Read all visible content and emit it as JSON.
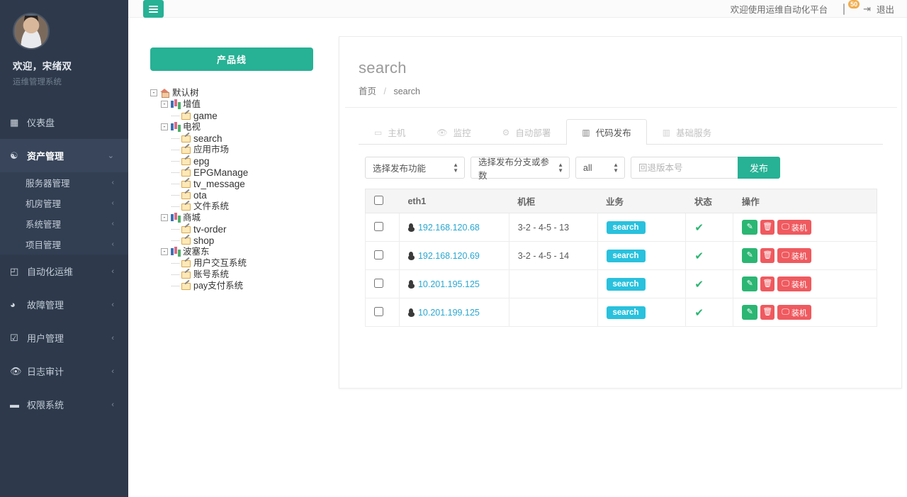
{
  "sidebar": {
    "profile": {
      "avatar_icon": "user-avatar",
      "welcome": "欢迎，宋绪双",
      "subtitle": "运维管理系统"
    },
    "items": [
      {
        "label": "仪表盘",
        "icon": "dashboard-icon",
        "active": false,
        "chevron": ""
      },
      {
        "label": "资产管理",
        "icon": "assets-icon",
        "active": true,
        "chevron": "⌄"
      },
      {
        "label": "自动化运维",
        "icon": "box-icon",
        "active": false,
        "chevron": "‹"
      },
      {
        "label": "故障管理",
        "icon": "bug-icon",
        "active": false,
        "chevron": "‹"
      },
      {
        "label": "用户管理",
        "icon": "edit-square-icon",
        "active": false,
        "chevron": "‹"
      },
      {
        "label": "日志审计",
        "icon": "eye-icon",
        "active": false,
        "chevron": "‹"
      },
      {
        "label": "权限系统",
        "icon": "briefcase-icon",
        "active": false,
        "chevron": "‹"
      }
    ],
    "subitems": [
      {
        "label": "服务器管理",
        "chevron": "‹"
      },
      {
        "label": "机房管理",
        "chevron": "‹"
      },
      {
        "label": "系统管理",
        "chevron": "‹"
      },
      {
        "label": "项目管理",
        "chevron": "‹"
      }
    ]
  },
  "topbar": {
    "menu_toggle_icon": "hamburger-icon",
    "welcome_text": "欢迎使用运维自动化平台",
    "mail_icon": "envelope-icon",
    "mail_badge": "50",
    "logout_icon": "logout-icon",
    "logout_label": "退出"
  },
  "tree_panel": {
    "product_line_button": "产品线",
    "nodes": [
      {
        "depth": 0,
        "toggle": "-",
        "icon": "home-icon",
        "label": "默认树",
        "latin": false
      },
      {
        "depth": 1,
        "toggle": "-",
        "icon": "bars-icon",
        "label": "增值",
        "latin": false
      },
      {
        "depth": 2,
        "toggle": "",
        "icon": "leaf-icon",
        "label": "game",
        "latin": true
      },
      {
        "depth": 1,
        "toggle": "-",
        "icon": "bars-icon",
        "label": "电视",
        "latin": false
      },
      {
        "depth": 2,
        "toggle": "",
        "icon": "leaf-icon",
        "label": "search",
        "latin": true
      },
      {
        "depth": 2,
        "toggle": "",
        "icon": "leaf-icon",
        "label": "应用市场",
        "latin": false
      },
      {
        "depth": 2,
        "toggle": "",
        "icon": "leaf-icon",
        "label": "epg",
        "latin": true
      },
      {
        "depth": 2,
        "toggle": "",
        "icon": "leaf-icon",
        "label": "EPGManage",
        "latin": true
      },
      {
        "depth": 2,
        "toggle": "",
        "icon": "leaf-icon",
        "label": "tv_message",
        "latin": true
      },
      {
        "depth": 2,
        "toggle": "",
        "icon": "leaf-icon",
        "label": "ota",
        "latin": true
      },
      {
        "depth": 2,
        "toggle": "",
        "icon": "leaf-icon",
        "label": "文件系统",
        "latin": false
      },
      {
        "depth": 1,
        "toggle": "-",
        "icon": "bars-icon",
        "label": "商城",
        "latin": false
      },
      {
        "depth": 2,
        "toggle": "",
        "icon": "leaf-icon",
        "label": "tv-order",
        "latin": true
      },
      {
        "depth": 2,
        "toggle": "",
        "icon": "leaf-icon",
        "label": "shop",
        "latin": true
      },
      {
        "depth": 1,
        "toggle": "-",
        "icon": "bars-icon",
        "label": "波塞东",
        "latin": false
      },
      {
        "depth": 2,
        "toggle": "",
        "icon": "leaf-icon",
        "label": "用户交互系统",
        "latin": false
      },
      {
        "depth": 2,
        "toggle": "",
        "icon": "leaf-icon",
        "label": "账号系统",
        "latin": false
      },
      {
        "depth": 2,
        "toggle": "",
        "icon": "leaf-icon",
        "label": "pay支付系统",
        "latin": false
      }
    ]
  },
  "main": {
    "page_title": "search",
    "breadcrumb": {
      "home": "首页",
      "separator": "/",
      "current": "search"
    },
    "tabs": [
      {
        "label": "主机",
        "icon": "laptop-icon",
        "active": false
      },
      {
        "label": "监控",
        "icon": "eye-icon",
        "active": false
      },
      {
        "label": "自动部署",
        "icon": "gears-icon",
        "active": false
      },
      {
        "label": "代码发布",
        "icon": "chart-icon",
        "active": true
      },
      {
        "label": "基础服务",
        "icon": "chart-icon",
        "active": false
      }
    ],
    "controls": {
      "select_function": "选择发布功能",
      "select_branch": "选择发布分支或参数",
      "select_all": "all",
      "rollback_placeholder": "回退版本号",
      "rollback_value": "",
      "publish_label": "发布"
    },
    "table": {
      "headers": [
        "",
        "eth1",
        "机柜",
        "业务",
        "状态",
        "操作"
      ],
      "select_all_checkbox": false,
      "rows": [
        {
          "checked": false,
          "ip": "192.168.120.68",
          "rack": "3-2 - 4-5 - 13",
          "biz": "search",
          "status": "✔"
        },
        {
          "checked": false,
          "ip": "192.168.120.69",
          "rack": "3-2 - 4-5 - 14",
          "biz": "search",
          "status": "✔"
        },
        {
          "checked": false,
          "ip": "10.201.195.125",
          "rack": "",
          "biz": "search",
          "status": "✔"
        },
        {
          "checked": false,
          "ip": "10.201.199.125",
          "rack": "",
          "biz": "search",
          "status": "✔"
        }
      ],
      "actions": {
        "edit_icon": "edit-icon",
        "delete_icon": "trash-icon",
        "install_icon": "monitor-icon",
        "install_label": "装机"
      }
    }
  },
  "colors": {
    "sidebar_bg": "#2e3a4c",
    "sidebar_active": "#38455a",
    "submenu_bg": "#323e52",
    "accent_green": "#27b195",
    "badge_cyan": "#29c1dd",
    "danger_red": "#ef5a5f",
    "success_green": "#2bb673",
    "link_blue": "#2aa7d0",
    "badge_orange": "#f0ad4e"
  }
}
